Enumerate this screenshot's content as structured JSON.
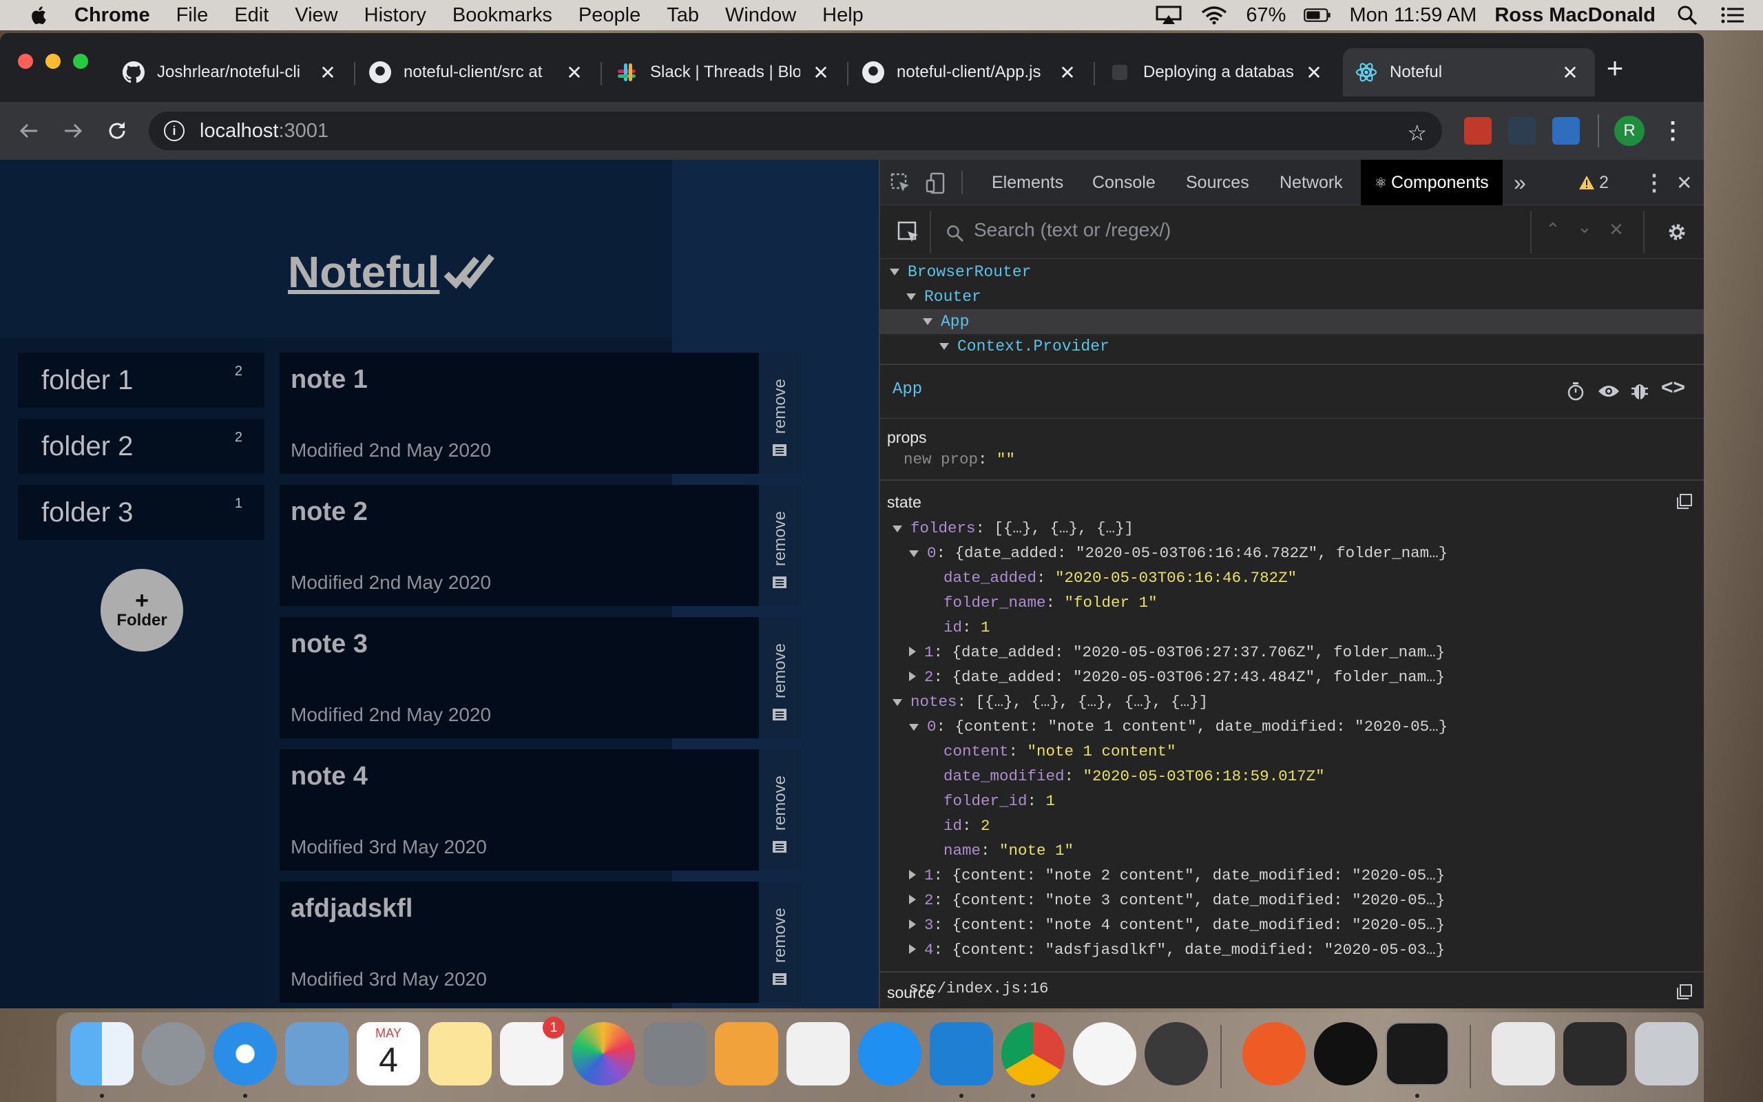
{
  "menubar": {
    "app": "Chrome",
    "items": [
      "File",
      "Edit",
      "View",
      "History",
      "Bookmarks",
      "People",
      "Tab",
      "Window",
      "Help"
    ],
    "battery": "67%",
    "clock": "Mon 11:59 AM",
    "user": "Ross MacDonald"
  },
  "tabs": [
    {
      "title": "Joshrlear/noteful-cli",
      "icon": "github-icon"
    },
    {
      "title": "noteful-client/src at",
      "icon": "github-icon"
    },
    {
      "title": "Slack | Threads | Blo",
      "icon": "slack-icon"
    },
    {
      "title": "noteful-client/App.js",
      "icon": "github-icon"
    },
    {
      "title": "Deploying a databas",
      "icon": "tab-icon"
    },
    {
      "title": "Noteful",
      "icon": "react-icon"
    }
  ],
  "address": {
    "host": "localhost",
    "port": ":3001"
  },
  "profile_initial": "R",
  "app": {
    "title": "Noteful",
    "folders": [
      {
        "name": "folder 1",
        "count": "2"
      },
      {
        "name": "folder 2",
        "count": "2"
      },
      {
        "name": "folder 3",
        "count": "1"
      }
    ],
    "add_folder": {
      "plus": "+",
      "label": "Folder"
    },
    "notes": [
      {
        "name": "note 1",
        "modified": "Modified 2nd May 2020"
      },
      {
        "name": "note 2",
        "modified": "Modified 2nd May 2020"
      },
      {
        "name": "note 3",
        "modified": "Modified 2nd May 2020"
      },
      {
        "name": "note 4",
        "modified": "Modified 3rd May 2020"
      },
      {
        "name": "afdjadskfl",
        "modified": "Modified 3rd May 2020"
      }
    ],
    "remove_label": "remove"
  },
  "devtools": {
    "tabs": [
      "Elements",
      "Console",
      "Sources",
      "Network",
      "Components"
    ],
    "more": "»",
    "warnings": "2",
    "search_placeholder": "Search (text or /regex/)",
    "tree": [
      "BrowserRouter",
      "Router",
      "App",
      "Context.Provider"
    ],
    "selected": "App",
    "props_label": "props",
    "props": {
      "key": "new prop",
      "value": "\"\""
    },
    "state_label": "state",
    "source_label": "source",
    "source": "src/index.js:16",
    "state_lines": {
      "folders": "[{…}, {…}, {…}]",
      "f0": "{date_added: \"2020-05-03T06:16:46.782Z\", folder_nam…}",
      "f0_date_added": "\"2020-05-03T06:16:46.782Z\"",
      "f0_folder_name": "\"folder 1\"",
      "f0_id": "1",
      "f1": "{date_added: \"2020-05-03T06:27:37.706Z\", folder_nam…}",
      "f2": "{date_added: \"2020-05-03T06:27:43.484Z\", folder_nam…}",
      "notes": "[{…}, {…}, {…}, {…}, {…}]",
      "n0": "{content: \"note 1 content\", date_modified: \"2020-05…}",
      "n0_content": "\"note 1 content\"",
      "n0_date_modified": "\"2020-05-03T06:18:59.017Z\"",
      "n0_folder_id": "1",
      "n0_id": "2",
      "n0_name": "\"note 1\"",
      "n1": "{content: \"note 2 content\", date_modified: \"2020-05…}",
      "n2": "{content: \"note 3 content\", date_modified: \"2020-05…}",
      "n3": "{content: \"note 4 content\", date_modified: \"2020-05…}",
      "n4": "{content: \"adsfjasdlkf\", date_modified: \"2020-05-03…}"
    }
  },
  "dock": {
    "calendar_month": "MAY",
    "calendar_day": "4",
    "reminders_badge": "1",
    "apps": [
      "finder-icon",
      "launchpad-icon",
      "safari-icon",
      "mail-icon",
      "calendar-icon",
      "notes-icon",
      "reminders-icon",
      "photos-icon",
      "system-preferences-icon",
      "pages-icon",
      "numbers-icon",
      "app-store-icon",
      "vscode-icon",
      "chrome-icon",
      "tableplus-icon",
      "instruments-icon",
      "postman-icon",
      "apple-tv-icon",
      "terminal-icon",
      "archive-icon",
      "screenshot-icon",
      "trash-icon"
    ]
  }
}
